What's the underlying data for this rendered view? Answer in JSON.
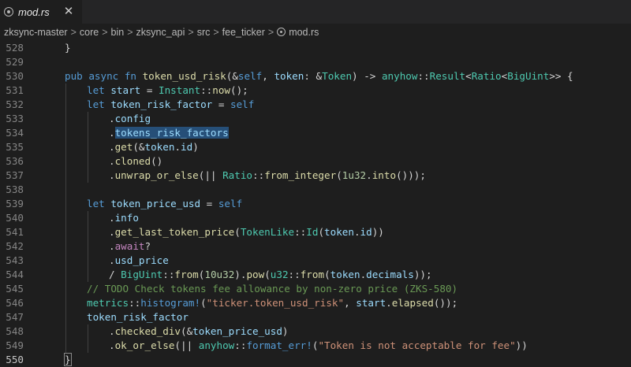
{
  "tab": {
    "filename": "mod.rs",
    "icon": "rust-file-icon",
    "close_glyph": "✕"
  },
  "breadcrumb": {
    "items": [
      "zksync-master",
      "core",
      "bin",
      "zksync_api",
      "src",
      "fee_ticker",
      "mod.rs"
    ],
    "separator": ">"
  },
  "editor": {
    "current_line": 550,
    "lines": [
      {
        "n": "528",
        "indent": 0,
        "tokens": [
          [
            "}",
            "#d4d4d4"
          ]
        ]
      },
      {
        "n": "529",
        "indent": 0,
        "tokens": []
      },
      {
        "n": "530",
        "indent": 0,
        "tokens": [
          [
            "pub ",
            "#569cd6"
          ],
          [
            "async ",
            "#569cd6"
          ],
          [
            "fn ",
            "#569cd6"
          ],
          [
            "token_usd_risk",
            "#dcdcaa"
          ],
          [
            "(&",
            "#d4d4d4"
          ],
          [
            "self",
            "#569cd6"
          ],
          [
            ", ",
            "#d4d4d4"
          ],
          [
            "token",
            "#9cdcfe"
          ],
          [
            ": &",
            "#d4d4d4"
          ],
          [
            "Token",
            "#4ec9b0"
          ],
          [
            ") -> ",
            "#d4d4d4"
          ],
          [
            "anyhow",
            "#4ec9b0"
          ],
          [
            "::",
            "#d4d4d4"
          ],
          [
            "Result",
            "#4ec9b0"
          ],
          [
            "<",
            "#d4d4d4"
          ],
          [
            "Ratio",
            "#4ec9b0"
          ],
          [
            "<",
            "#d4d4d4"
          ],
          [
            "BigUint",
            "#4ec9b0"
          ],
          [
            ">> {",
            "#d4d4d4"
          ]
        ]
      },
      {
        "n": "531",
        "indent": 1,
        "tokens": [
          [
            "let ",
            "#569cd6"
          ],
          [
            "start",
            "#9cdcfe"
          ],
          [
            " = ",
            "#d4d4d4"
          ],
          [
            "Instant",
            "#4ec9b0"
          ],
          [
            "::",
            "#d4d4d4"
          ],
          [
            "now",
            "#dcdcaa"
          ],
          [
            "();",
            "#d4d4d4"
          ]
        ]
      },
      {
        "n": "532",
        "indent": 1,
        "tokens": [
          [
            "let ",
            "#569cd6"
          ],
          [
            "token_risk_factor",
            "#9cdcfe"
          ],
          [
            " = ",
            "#d4d4d4"
          ],
          [
            "self",
            "#569cd6"
          ]
        ]
      },
      {
        "n": "533",
        "indent": 2,
        "tokens": [
          [
            ".",
            "#d4d4d4"
          ],
          [
            "config",
            "#9cdcfe"
          ]
        ]
      },
      {
        "n": "534",
        "indent": 2,
        "tokens": [
          [
            ".",
            "#d4d4d4"
          ],
          [
            "tokens_risk_factors",
            "#9cdcfe",
            "sel"
          ]
        ]
      },
      {
        "n": "535",
        "indent": 2,
        "tokens": [
          [
            ".",
            "#d4d4d4"
          ],
          [
            "get",
            "#dcdcaa"
          ],
          [
            "(&",
            "#d4d4d4"
          ],
          [
            "token",
            "#9cdcfe"
          ],
          [
            ".",
            "#d4d4d4"
          ],
          [
            "id",
            "#9cdcfe"
          ],
          [
            ")",
            "#d4d4d4"
          ]
        ]
      },
      {
        "n": "536",
        "indent": 2,
        "tokens": [
          [
            ".",
            "#d4d4d4"
          ],
          [
            "cloned",
            "#dcdcaa"
          ],
          [
            "()",
            "#d4d4d4"
          ]
        ]
      },
      {
        "n": "537",
        "indent": 2,
        "tokens": [
          [
            ".",
            "#d4d4d4"
          ],
          [
            "unwrap_or_else",
            "#dcdcaa"
          ],
          [
            "(|| ",
            "#d4d4d4"
          ],
          [
            "Ratio",
            "#4ec9b0"
          ],
          [
            "::",
            "#d4d4d4"
          ],
          [
            "from_integer",
            "#dcdcaa"
          ],
          [
            "(",
            "#d4d4d4"
          ],
          [
            "1u32",
            "#b5cea8"
          ],
          [
            ".",
            "#d4d4d4"
          ],
          [
            "into",
            "#dcdcaa"
          ],
          [
            "()));",
            "#d4d4d4"
          ]
        ]
      },
      {
        "n": "538",
        "indent": 0,
        "tokens": []
      },
      {
        "n": "539",
        "indent": 1,
        "tokens": [
          [
            "let ",
            "#569cd6"
          ],
          [
            "token_price_usd",
            "#9cdcfe"
          ],
          [
            " = ",
            "#d4d4d4"
          ],
          [
            "self",
            "#569cd6"
          ]
        ]
      },
      {
        "n": "540",
        "indent": 2,
        "tokens": [
          [
            ".",
            "#d4d4d4"
          ],
          [
            "info",
            "#9cdcfe"
          ]
        ]
      },
      {
        "n": "541",
        "indent": 2,
        "tokens": [
          [
            ".",
            "#d4d4d4"
          ],
          [
            "get_last_token_price",
            "#dcdcaa"
          ],
          [
            "(",
            "#d4d4d4"
          ],
          [
            "TokenLike",
            "#4ec9b0"
          ],
          [
            "::",
            "#d4d4d4"
          ],
          [
            "Id",
            "#4ec9b0"
          ],
          [
            "(",
            "#d4d4d4"
          ],
          [
            "token",
            "#9cdcfe"
          ],
          [
            ".",
            "#d4d4d4"
          ],
          [
            "id",
            "#9cdcfe"
          ],
          [
            "))",
            "#d4d4d4"
          ]
        ]
      },
      {
        "n": "542",
        "indent": 2,
        "tokens": [
          [
            ".",
            "#d4d4d4"
          ],
          [
            "await",
            "#c586c0"
          ],
          [
            "?",
            "#d4d4d4"
          ]
        ]
      },
      {
        "n": "543",
        "indent": 2,
        "tokens": [
          [
            ".",
            "#d4d4d4"
          ],
          [
            "usd_price",
            "#9cdcfe"
          ]
        ]
      },
      {
        "n": "544",
        "indent": 2,
        "tokens": [
          [
            "/ ",
            "#d4d4d4"
          ],
          [
            "BigUint",
            "#4ec9b0"
          ],
          [
            "::",
            "#d4d4d4"
          ],
          [
            "from",
            "#dcdcaa"
          ],
          [
            "(",
            "#d4d4d4"
          ],
          [
            "10u32",
            "#b5cea8"
          ],
          [
            ").",
            "#d4d4d4"
          ],
          [
            "pow",
            "#dcdcaa"
          ],
          [
            "(",
            "#d4d4d4"
          ],
          [
            "u32",
            "#4ec9b0"
          ],
          [
            "::",
            "#d4d4d4"
          ],
          [
            "from",
            "#dcdcaa"
          ],
          [
            "(",
            "#d4d4d4"
          ],
          [
            "token",
            "#9cdcfe"
          ],
          [
            ".",
            "#d4d4d4"
          ],
          [
            "decimals",
            "#9cdcfe"
          ],
          [
            "));",
            "#d4d4d4"
          ]
        ]
      },
      {
        "n": "545",
        "indent": 1,
        "tokens": [
          [
            "// TODO Check tokens fee allowance by non-zero price (ZKS-580)",
            "#6a9955"
          ]
        ]
      },
      {
        "n": "546",
        "indent": 1,
        "tokens": [
          [
            "metrics",
            "#4ec9b0"
          ],
          [
            "::",
            "#d4d4d4"
          ],
          [
            "histogram!",
            "#569cd6"
          ],
          [
            "(",
            "#d4d4d4"
          ],
          [
            "\"ticker.token_usd_risk\"",
            "#ce9178"
          ],
          [
            ", ",
            "#d4d4d4"
          ],
          [
            "start",
            "#9cdcfe"
          ],
          [
            ".",
            "#d4d4d4"
          ],
          [
            "elapsed",
            "#dcdcaa"
          ],
          [
            "());",
            "#d4d4d4"
          ]
        ]
      },
      {
        "n": "547",
        "indent": 1,
        "tokens": [
          [
            "token_risk_factor",
            "#9cdcfe"
          ]
        ]
      },
      {
        "n": "548",
        "indent": 2,
        "tokens": [
          [
            ".",
            "#d4d4d4"
          ],
          [
            "checked_div",
            "#dcdcaa"
          ],
          [
            "(&",
            "#d4d4d4"
          ],
          [
            "token_price_usd",
            "#9cdcfe"
          ],
          [
            ")",
            "#d4d4d4"
          ]
        ]
      },
      {
        "n": "549",
        "indent": 2,
        "tokens": [
          [
            ".",
            "#d4d4d4"
          ],
          [
            "ok_or_else",
            "#dcdcaa"
          ],
          [
            "(|| ",
            "#d4d4d4"
          ],
          [
            "anyhow",
            "#4ec9b0"
          ],
          [
            "::",
            "#d4d4d4"
          ],
          [
            "format_err!",
            "#569cd6"
          ],
          [
            "(",
            "#d4d4d4"
          ],
          [
            "\"Token is not acceptable for fee\"",
            "#ce9178"
          ],
          [
            "))",
            "#d4d4d4"
          ]
        ]
      },
      {
        "n": "550",
        "indent": 0,
        "tokens": [
          [
            "}",
            "#d4d4d4",
            "bracket"
          ]
        ]
      }
    ]
  }
}
